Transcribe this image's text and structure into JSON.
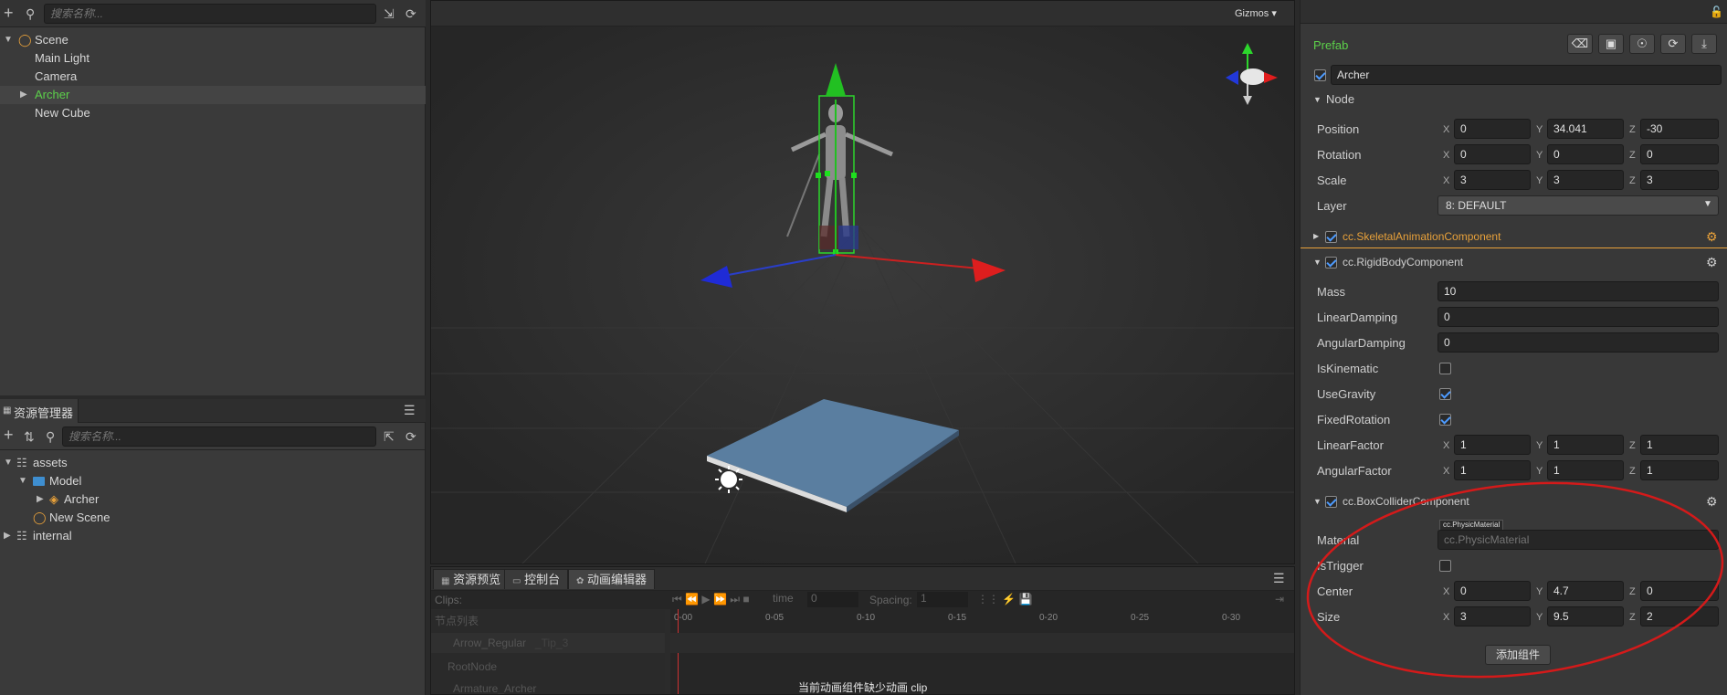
{
  "hierarchy": {
    "search_placeholder": "搜索名称...",
    "items": [
      {
        "label": "Scene"
      },
      {
        "label": "Main Light"
      },
      {
        "label": "Camera"
      },
      {
        "label": "Archer"
      },
      {
        "label": "New Cube"
      }
    ]
  },
  "assets": {
    "title": "资源管理器",
    "search_placeholder": "搜索名称...",
    "items": [
      {
        "label": "assets"
      },
      {
        "label": "Model"
      },
      {
        "label": "Archer"
      },
      {
        "label": "New Scene"
      },
      {
        "label": "internal"
      }
    ]
  },
  "scene_view": {
    "gizmos_label": "Gizmos"
  },
  "bottom_panel": {
    "tabs": [
      {
        "label": "资源预览"
      },
      {
        "label": "控制台"
      },
      {
        "label": "动画编辑器"
      }
    ],
    "clips_label": "Clips:",
    "time_label": "time",
    "time_value": "0",
    "spacing_label": "Spacing:",
    "spacing_value": "1",
    "node_list_label": "节点列表",
    "nodes": [
      "Arrow_Regular",
      "RootNode",
      "Armature_Archer"
    ],
    "ghost_text": "_Tip_3",
    "ticks": [
      "0-00",
      "0-05",
      "0-10",
      "0-15",
      "0-20",
      "0-25",
      "0-30"
    ],
    "missing_clip_msg": "当前动画组件缺少动画 clip"
  },
  "inspector": {
    "prefab_label": "Prefab",
    "node_name": "Archer",
    "node_section": "Node",
    "position": {
      "label": "Position",
      "x": "0",
      "y": "34.041",
      "z": "-30"
    },
    "rotation": {
      "label": "Rotation",
      "x": "0",
      "y": "0",
      "z": "0"
    },
    "scale": {
      "label": "Scale",
      "x": "3",
      "y": "3",
      "z": "3"
    },
    "layer": {
      "label": "Layer",
      "value": "8: DEFAULT"
    },
    "skeletal": {
      "name": "cc.SkeletalAnimationComponent"
    },
    "rigidbody": {
      "name": "cc.RigidBodyComponent",
      "mass": {
        "label": "Mass",
        "value": "10"
      },
      "linear_damping": {
        "label": "LinearDamping",
        "value": "0"
      },
      "angular_damping": {
        "label": "AngularDamping",
        "value": "0"
      },
      "is_kinematic": {
        "label": "IsKinematic",
        "checked": false
      },
      "use_gravity": {
        "label": "UseGravity",
        "checked": true
      },
      "fixed_rotation": {
        "label": "FixedRotation",
        "checked": true
      },
      "linear_factor": {
        "label": "LinearFactor",
        "x": "1",
        "y": "1",
        "z": "1"
      },
      "angular_factor": {
        "label": "AngularFactor",
        "x": "1",
        "y": "1",
        "z": "1"
      }
    },
    "boxcollider": {
      "name": "cc.BoxColliderComponent",
      "material": {
        "label": "Material",
        "tag": "cc.PhysicMaterial",
        "placeholder": "cc.PhysicMaterial"
      },
      "is_trigger": {
        "label": "IsTrigger",
        "checked": false
      },
      "center": {
        "label": "Center",
        "x": "0",
        "y": "4.7",
        "z": "0"
      },
      "size": {
        "label": "Size",
        "x": "3",
        "y": "9.5",
        "z": "2"
      }
    },
    "add_component_label": "添加组件",
    "axis_x": "X",
    "axis_y": "Y",
    "axis_z": "Z"
  },
  "colors": {
    "accent_green": "#5cd14a",
    "skeletal_orange": "#e8a13a",
    "annotation_red": "#d41a1a"
  }
}
